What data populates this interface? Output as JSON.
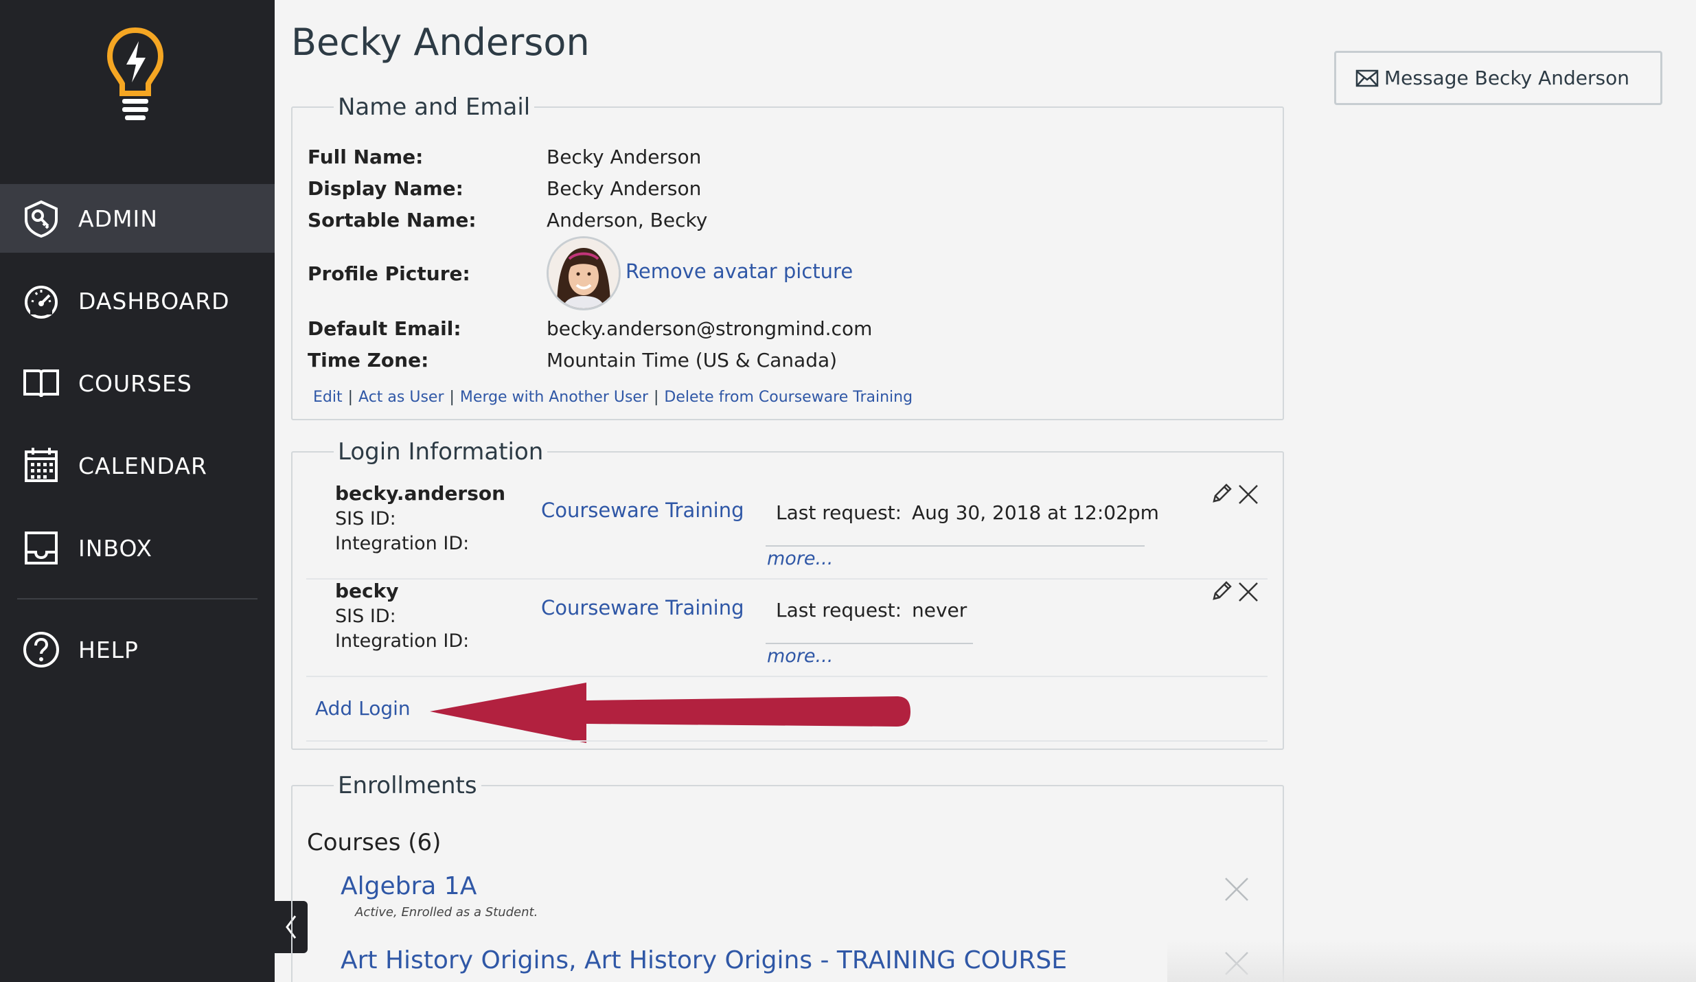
{
  "sidebar": {
    "logo_icon": "lightbulb-bolt-icon",
    "items": [
      {
        "label": "ADMIN",
        "icon": "shield-key-icon",
        "active": true
      },
      {
        "label": "DASHBOARD",
        "icon": "speedometer-icon",
        "active": false
      },
      {
        "label": "COURSES",
        "icon": "book-icon",
        "active": false
      },
      {
        "label": "CALENDAR",
        "icon": "calendar-icon",
        "active": false
      },
      {
        "label": "INBOX",
        "icon": "inbox-tray-icon",
        "active": false
      },
      {
        "label": "HELP",
        "icon": "question-circle-icon",
        "active": false
      }
    ],
    "collapse_icon": "chevron-left-icon"
  },
  "page": {
    "title": "Becky Anderson",
    "message_button": "Message Becky Anderson"
  },
  "name_email": {
    "legend": "Name and Email",
    "full_name_label": "Full Name:",
    "full_name": "Becky Anderson",
    "display_name_label": "Display Name:",
    "display_name": "Becky Anderson",
    "sortable_name_label": "Sortable Name:",
    "sortable_name": "Anderson, Becky",
    "profile_picture_label": "Profile Picture:",
    "remove_avatar": "Remove avatar picture",
    "default_email_label": "Default Email:",
    "default_email": "becky.anderson@strongmind.com",
    "time_zone_label": "Time Zone:",
    "time_zone": "Mountain Time (US & Canada)",
    "actions": {
      "edit": "Edit",
      "act_as_user": "Act as User",
      "merge": "Merge with Another User",
      "delete": "Delete from Courseware Training",
      "separator": "|"
    }
  },
  "login_info": {
    "legend": "Login Information",
    "logins": [
      {
        "username": "becky.anderson",
        "sis_label": "SIS ID:",
        "integration_label": "Integration ID:",
        "account": "Courseware Training",
        "last_request_label": "Last request:",
        "last_request": "Aug 30, 2018 at 12:02pm",
        "more": "more..."
      },
      {
        "username": "becky",
        "sis_label": "SIS ID:",
        "integration_label": "Integration ID:",
        "account": "Courseware Training",
        "last_request_label": "Last request:",
        "last_request": "never",
        "more": "more..."
      }
    ],
    "add_login": "Add Login",
    "annotation_color": "#b2213f"
  },
  "enrollments": {
    "legend": "Enrollments",
    "courses_heading": "Courses (6)",
    "courses": [
      {
        "title": "Algebra 1A",
        "status": "Active, Enrolled as a Student."
      },
      {
        "title": "Art History Origins, Art History Origins - TRAINING COURSE",
        "status": ""
      }
    ]
  },
  "colors": {
    "sidebar_bg": "#222327",
    "sidebar_active": "#3a3c43",
    "link": "#2f57a6",
    "logo_accent": "#f5a623"
  }
}
